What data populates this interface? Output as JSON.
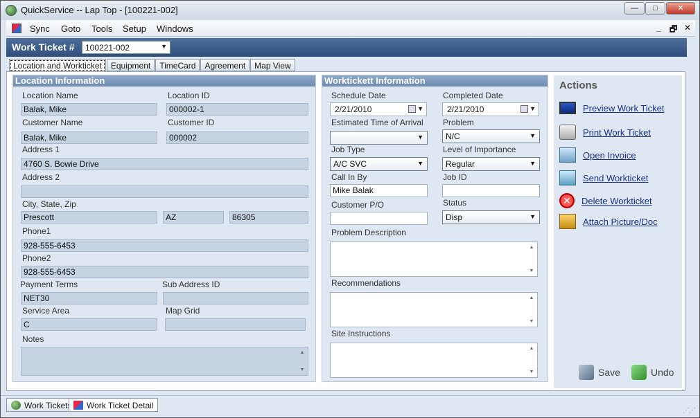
{
  "window": {
    "title": "QuickService -- Lap Top - [100221-002]",
    "buttons": {
      "minimize": "—",
      "maximize": "□",
      "close": "✕"
    }
  },
  "menu": {
    "items": [
      "Sync",
      "Goto",
      "Tools",
      "Setup",
      "Windows"
    ],
    "mdi": {
      "minimize": "_",
      "restore": "🗗",
      "close": "✕"
    }
  },
  "ticket": {
    "label": "Work Ticket #",
    "number": "100221-002"
  },
  "tabs": [
    "Location and Workticket",
    "Equipment",
    "TimeCard",
    "Agreement",
    "Map View"
  ],
  "location": {
    "header": "Location Information",
    "location_name_label": "Location Name",
    "location_name": "Balak, Mike",
    "location_id_label": "Location ID",
    "location_id": "000002-1",
    "customer_name_label": "Customer Name",
    "customer_name": "Balak, Mike",
    "customer_id_label": "Customer ID",
    "customer_id": "000002",
    "address1_label": "Address 1",
    "address1": "4760 S. Bowie Drive",
    "address2_label": "Address 2",
    "address2": "",
    "csz_label": "City, State, Zip",
    "city": "Prescott",
    "state": "AZ",
    "zip": "86305",
    "phone1_label": "Phone1",
    "phone1": "928-555-6453",
    "phone2_label": "Phone2",
    "phone2": "928-555-6453",
    "payment_terms_label": "Payment Terms",
    "payment_terms": "NET30",
    "sub_address_label": "Sub Address ID",
    "sub_address": "",
    "service_area_label": "Service Area",
    "service_area": "C",
    "map_grid_label": "Map Grid",
    "map_grid": "",
    "notes_label": "Notes",
    "notes": ""
  },
  "workticket": {
    "header": "Worktickett Information",
    "schedule_date_label": "Schedule Date",
    "schedule_date": "2/21/2010",
    "completed_date_label": "Completed Date",
    "completed_date": "2/21/2010",
    "eta_label": "Estimated Time of Arrival",
    "eta": "",
    "problem_label": "Problem",
    "problem": "N/C",
    "job_type_label": "Job Type",
    "job_type": "A/C SVC",
    "importance_label": "Level of Importance",
    "importance": "Regular",
    "call_in_by_label": "Call In By",
    "call_in_by": "Mike Balak",
    "job_id_label": "Job ID",
    "job_id": "",
    "customer_po_label": "Customer P/O",
    "customer_po": "",
    "status_label": "Status",
    "status": "Disp",
    "problem_desc_label": "Problem Description",
    "recommendations_label": "Recommendations",
    "site_instructions_label": "Site Instructions"
  },
  "actions": {
    "title": "Actions",
    "items": [
      {
        "label": "Preview Work Ticket",
        "icon": "monitor-icon"
      },
      {
        "label": "Print Work Ticket",
        "icon": "printer-icon"
      },
      {
        "label": "Open Invoice",
        "icon": "invoice-icon"
      },
      {
        "label": "Send Workticket",
        "icon": "send-icon"
      },
      {
        "label": "Delete Workticket",
        "icon": "delete-icon"
      },
      {
        "label": "Attach Picture/Doc",
        "icon": "attach-icon"
      }
    ],
    "save": "Save",
    "undo": "Undo"
  },
  "taskbar": {
    "tabs": [
      "Work Tickets",
      "Work Ticket Detail"
    ]
  }
}
